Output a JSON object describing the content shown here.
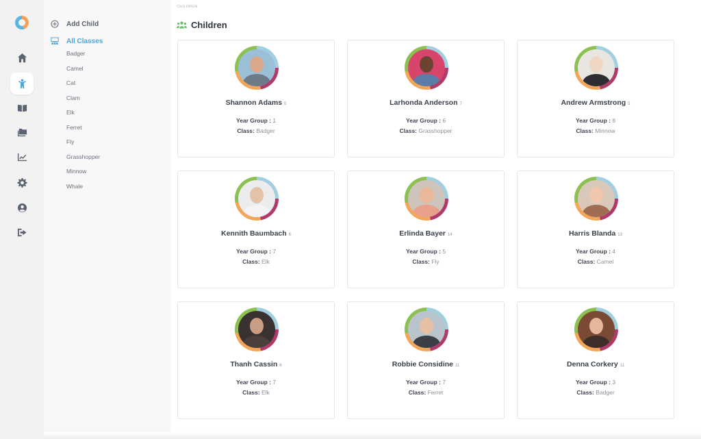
{
  "nav": {
    "logo": "app-logo",
    "items": [
      {
        "icon": "home-icon",
        "active": false
      },
      {
        "icon": "child-icon",
        "active": true
      },
      {
        "icon": "book-icon",
        "active": false
      },
      {
        "icon": "folders-icon",
        "active": false
      },
      {
        "icon": "chart-icon",
        "active": false
      },
      {
        "icon": "gear-icon",
        "active": false
      },
      {
        "icon": "user-circle-icon",
        "active": false
      },
      {
        "icon": "logout-icon",
        "active": false
      }
    ]
  },
  "subnav": {
    "add_child": "Add Child",
    "all_classes": "All Classes",
    "classes": [
      "Badger",
      "Camel",
      "Cat",
      "Clam",
      "Elk",
      "Ferret",
      "Fly",
      "Grasshopper",
      "Minnow",
      "Whale"
    ]
  },
  "breadcrumb": "CHILDREN",
  "page_title": "Children",
  "labels": {
    "year_group": "Year Group :",
    "class": "Class:"
  },
  "colors": {
    "accent": "#4aa8d8",
    "title_icon": "#6cbf6a",
    "ring": [
      "#a1cfe0",
      "#b03a6a",
      "#f2a65a",
      "#8cc152"
    ]
  },
  "children": [
    {
      "name": "Shannon Adams",
      "age": "5",
      "year_group": "1",
      "class": "Badger"
    },
    {
      "name": "Larhonda Anderson",
      "age": "7",
      "year_group": "6",
      "class": "Grasshopper"
    },
    {
      "name": "Andrew Armstrong",
      "age": "5",
      "year_group": "8",
      "class": "Minnow"
    },
    {
      "name": "Kennith Baumbach",
      "age": "6",
      "year_group": "7",
      "class": "Elk"
    },
    {
      "name": "Erlinda Bayer",
      "age": "14",
      "year_group": "5",
      "class": "Fly"
    },
    {
      "name": "Harris Blanda",
      "age": "13",
      "year_group": "4",
      "class": "Camel"
    },
    {
      "name": "Thanh Cassin",
      "age": "6",
      "year_group": "7",
      "class": "Elk"
    },
    {
      "name": "Robbie Considine",
      "age": "11",
      "year_group": "7",
      "class": "Ferret"
    },
    {
      "name": "Denna Corkery",
      "age": "11",
      "year_group": "3",
      "class": "Badger"
    }
  ]
}
